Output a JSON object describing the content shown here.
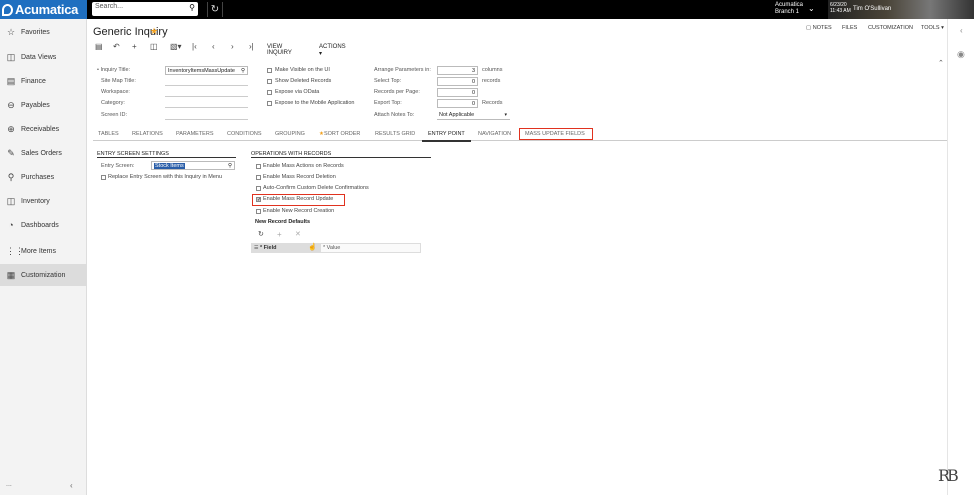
{
  "topbar": {
    "logo_text": "Acumatica",
    "search_placeholder": "Search...",
    "tenant_name": "Acumatica",
    "branch": "Branch 1",
    "date": "6/23/20",
    "time": "11:43 AM",
    "user_name": "Tim O'Sullivan"
  },
  "sidebar": {
    "items": [
      {
        "label": "Favorites",
        "icon": "star-icon"
      },
      {
        "label": "Data Views",
        "icon": "data-views-icon"
      },
      {
        "label": "Finance",
        "icon": "finance-icon"
      },
      {
        "label": "Payables",
        "icon": "payables-icon"
      },
      {
        "label": "Receivables",
        "icon": "receivables-icon"
      },
      {
        "label": "Sales Orders",
        "icon": "sales-orders-icon"
      },
      {
        "label": "Purchases",
        "icon": "purchases-icon"
      },
      {
        "label": "Inventory",
        "icon": "inventory-icon"
      },
      {
        "label": "Dashboards",
        "icon": "dashboards-icon"
      },
      {
        "label": "More Items",
        "icon": "grid-icon"
      },
      {
        "label": "Customization",
        "icon": "puzzle-icon"
      }
    ],
    "bottom_dots": "...",
    "collapse": "‹"
  },
  "page": {
    "title": "Generic Inquiry",
    "links": {
      "notes": "NOTES",
      "files": "FILES",
      "customization": "CUSTOMIZATION",
      "tools": "TOOLS"
    }
  },
  "toolbar": {
    "view_inquiry": "VIEW INQUIRY",
    "actions": "ACTIONS"
  },
  "form": {
    "inquiry_title_label": "Inquiry Title:",
    "inquiry_title_value": "InventoryItemsMassUpdate",
    "site_map_title_label": "Site Map Title:",
    "workspace_label": "Workspace:",
    "category_label": "Category:",
    "screen_id_label": "Screen ID:",
    "make_visible": "Make Visible on the UI",
    "show_deleted": "Show Deleted Records",
    "expose_odata": "Expose via OData",
    "expose_mobile": "Expose to the Mobile Application",
    "arrange_params_label": "Arrange Parameters in:",
    "arrange_params_value": "3",
    "arrange_params_unit": "columns",
    "select_top_label": "Select Top:",
    "select_top_value": "0",
    "select_top_unit": "records",
    "records_per_page_label": "Records per Page:",
    "records_per_page_value": "0",
    "export_top_label": "Export Top:",
    "export_top_value": "0",
    "export_top_unit": "Records",
    "attach_notes_label": "Attach Notes To:",
    "attach_notes_value": "Not Applicable"
  },
  "tabs": [
    "TABLES",
    "RELATIONS",
    "PARAMETERS",
    "CONDITIONS",
    "GROUPING",
    "SORT ORDER",
    "RESULTS GRID",
    "ENTRY POINT",
    "NAVIGATION",
    "MASS UPDATE FIELDS"
  ],
  "entry_screen": {
    "header": "ENTRY SCREEN SETTINGS",
    "entry_screen_label": "Entry Screen:",
    "entry_screen_value": "Stock Items",
    "replace_entry": "Replace Entry Screen with this Inquiry in Menu"
  },
  "operations": {
    "header": "OPERATIONS WITH RECORDS",
    "enable_mass_actions": "Enable Mass Actions on Records",
    "enable_mass_deletion": "Enable Mass Record Deletion",
    "auto_confirm": "Auto-Confirm Custom Delete Confirmations",
    "enable_mass_update": "Enable Mass Record Update",
    "enable_new_record": "Enable New Record Creation",
    "enable_mass_update_checked": true
  },
  "defaults": {
    "header": "New Record Defaults",
    "col_field": "Field",
    "col_value": "Value"
  },
  "colors": {
    "accent": "#1f6fc0",
    "highlight": "#e0321f",
    "star": "#f3a21e"
  }
}
